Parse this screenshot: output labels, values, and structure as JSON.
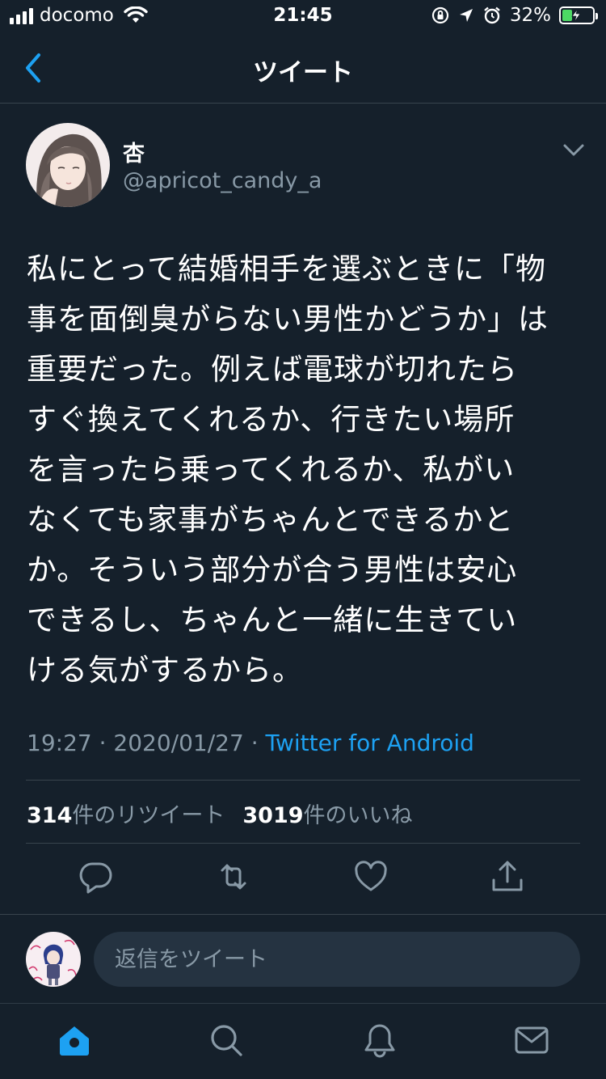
{
  "status_bar": {
    "carrier": "docomo",
    "time": "21:45",
    "battery_percent": "32%",
    "battery_level": 0.32,
    "battery_color": "#4cd964"
  },
  "header": {
    "title": "ツイート",
    "back_icon": "chevron-left-icon"
  },
  "tweet": {
    "display_name": "杏",
    "handle": "@apricot_candy_a",
    "lines": [
      "私にとって結婚相手を選ぶときに「物",
      "事を面倒臭がらない男性かどうか」は",
      "重要だった。例えば電球が切れたら",
      "すぐ換えてくれるか、行きたい場所",
      "を言ったら乗ってくれるか、私がい",
      "なくても家事がちゃんとできるかと",
      "か。そういう部分が合う男性は安心",
      "できるし、ちゃんと一緒に生きてい",
      "ける気がするから。"
    ],
    "time": "19:27",
    "date": "2020/01/27",
    "separator": "·",
    "source": "Twitter for Android",
    "retweet_count": "314",
    "retweet_label": "件のリツイート",
    "like_count": "3019",
    "like_label": "件のいいね"
  },
  "actions": [
    "reply-icon",
    "retweet-icon",
    "like-icon",
    "share-icon"
  ],
  "reply": {
    "placeholder": "返信をツイート"
  },
  "tabbar": [
    "home-icon",
    "search-icon",
    "notifications-icon",
    "messages-icon"
  ],
  "colors": {
    "background": "#15202b",
    "accent": "#1da1f2",
    "secondary_text": "#8899a6",
    "divider": "#38444d",
    "input_bg": "#253341"
  }
}
